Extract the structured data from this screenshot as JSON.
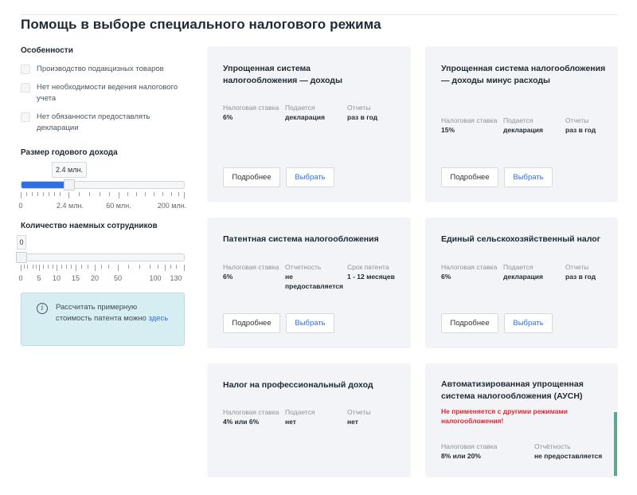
{
  "page": {
    "title": "Помощь в выборе специального налогового режима"
  },
  "sidebar": {
    "features_title": "Особенности",
    "features": [
      "Производство подакцизных товаров",
      "Нет необходимости ведения налогового учета",
      "Нет обязанности предоставлять декларации"
    ],
    "income": {
      "title": "Размер годового дохода",
      "tooltip": "2.4 млн.",
      "value_mln": 2.4,
      "tick_labels": [
        "0",
        "2.4 млн.",
        "60 млн.",
        "200 млн."
      ]
    },
    "employees": {
      "title": "Количество наемных сотрудников",
      "tooltip": "0",
      "value": 0,
      "tick_labels": [
        "0",
        "5",
        "10",
        "15",
        "20",
        "50",
        "100",
        "130"
      ]
    },
    "info": {
      "icon": "info-icon",
      "text": "Рассчитать примерную стоимость патента можно",
      "link": "здесь"
    }
  },
  "cards": [
    {
      "title": "Упрощенная система налогообложения — доходы",
      "props": [
        {
          "label": "Налоговая ставка",
          "value": "6%"
        },
        {
          "label": "Подается",
          "value": "декларация"
        },
        {
          "label": "Отчеты",
          "value": "раз в год"
        }
      ],
      "more_label": "Подробнее",
      "select_label": "Выбрать"
    },
    {
      "title": "Упрощенная система налогообложения — доходы минус расходы",
      "props": [
        {
          "label": "Налоговая ставка",
          "value": "15%"
        },
        {
          "label": "Подается",
          "value": "декларация"
        },
        {
          "label": "Отчеты",
          "value": "раз в год"
        }
      ],
      "more_label": "Подробнее",
      "select_label": "Выбрать"
    },
    {
      "title": "Патентная система налогообложения",
      "props": [
        {
          "label": "Налоговая ставка",
          "value": "6%"
        },
        {
          "label": "Отчетность",
          "value": "не предоставляется"
        },
        {
          "label": "Срок патента",
          "value": "1 - 12 месяцев"
        }
      ],
      "more_label": "Подробнее",
      "select_label": "Выбрать"
    },
    {
      "title": "Единый сельскохозяйственный налог",
      "props": [
        {
          "label": "Налоговая ставка",
          "value": "6%"
        },
        {
          "label": "Подается",
          "value": "декларация"
        },
        {
          "label": "Отчеты",
          "value": "раз в год"
        }
      ],
      "more_label": "Подробнее",
      "select_label": "Выбрать"
    },
    {
      "title": "Налог на профессиональный доход",
      "props": [
        {
          "label": "Налоговая ставка",
          "value": "4% или 6%"
        },
        {
          "label": "Подается",
          "value": "нет"
        },
        {
          "label": "Отчеты",
          "value": "нет"
        }
      ]
    },
    {
      "title": "Автоматизированная упрощенная система налогообложения (АУСН)",
      "warning": "Не применяется с другими режимами налогообложения!",
      "props": [
        {
          "label": "Налоговая ставка",
          "value": "8% или 20%"
        },
        {
          "label": "Отчётность",
          "value": "не предоставляется"
        }
      ]
    }
  ],
  "colors": {
    "accent": "#2f6fe5",
    "warning": "#e0242e",
    "card_bg": "#f3f4f7",
    "info_bg": "#d6eef1"
  }
}
